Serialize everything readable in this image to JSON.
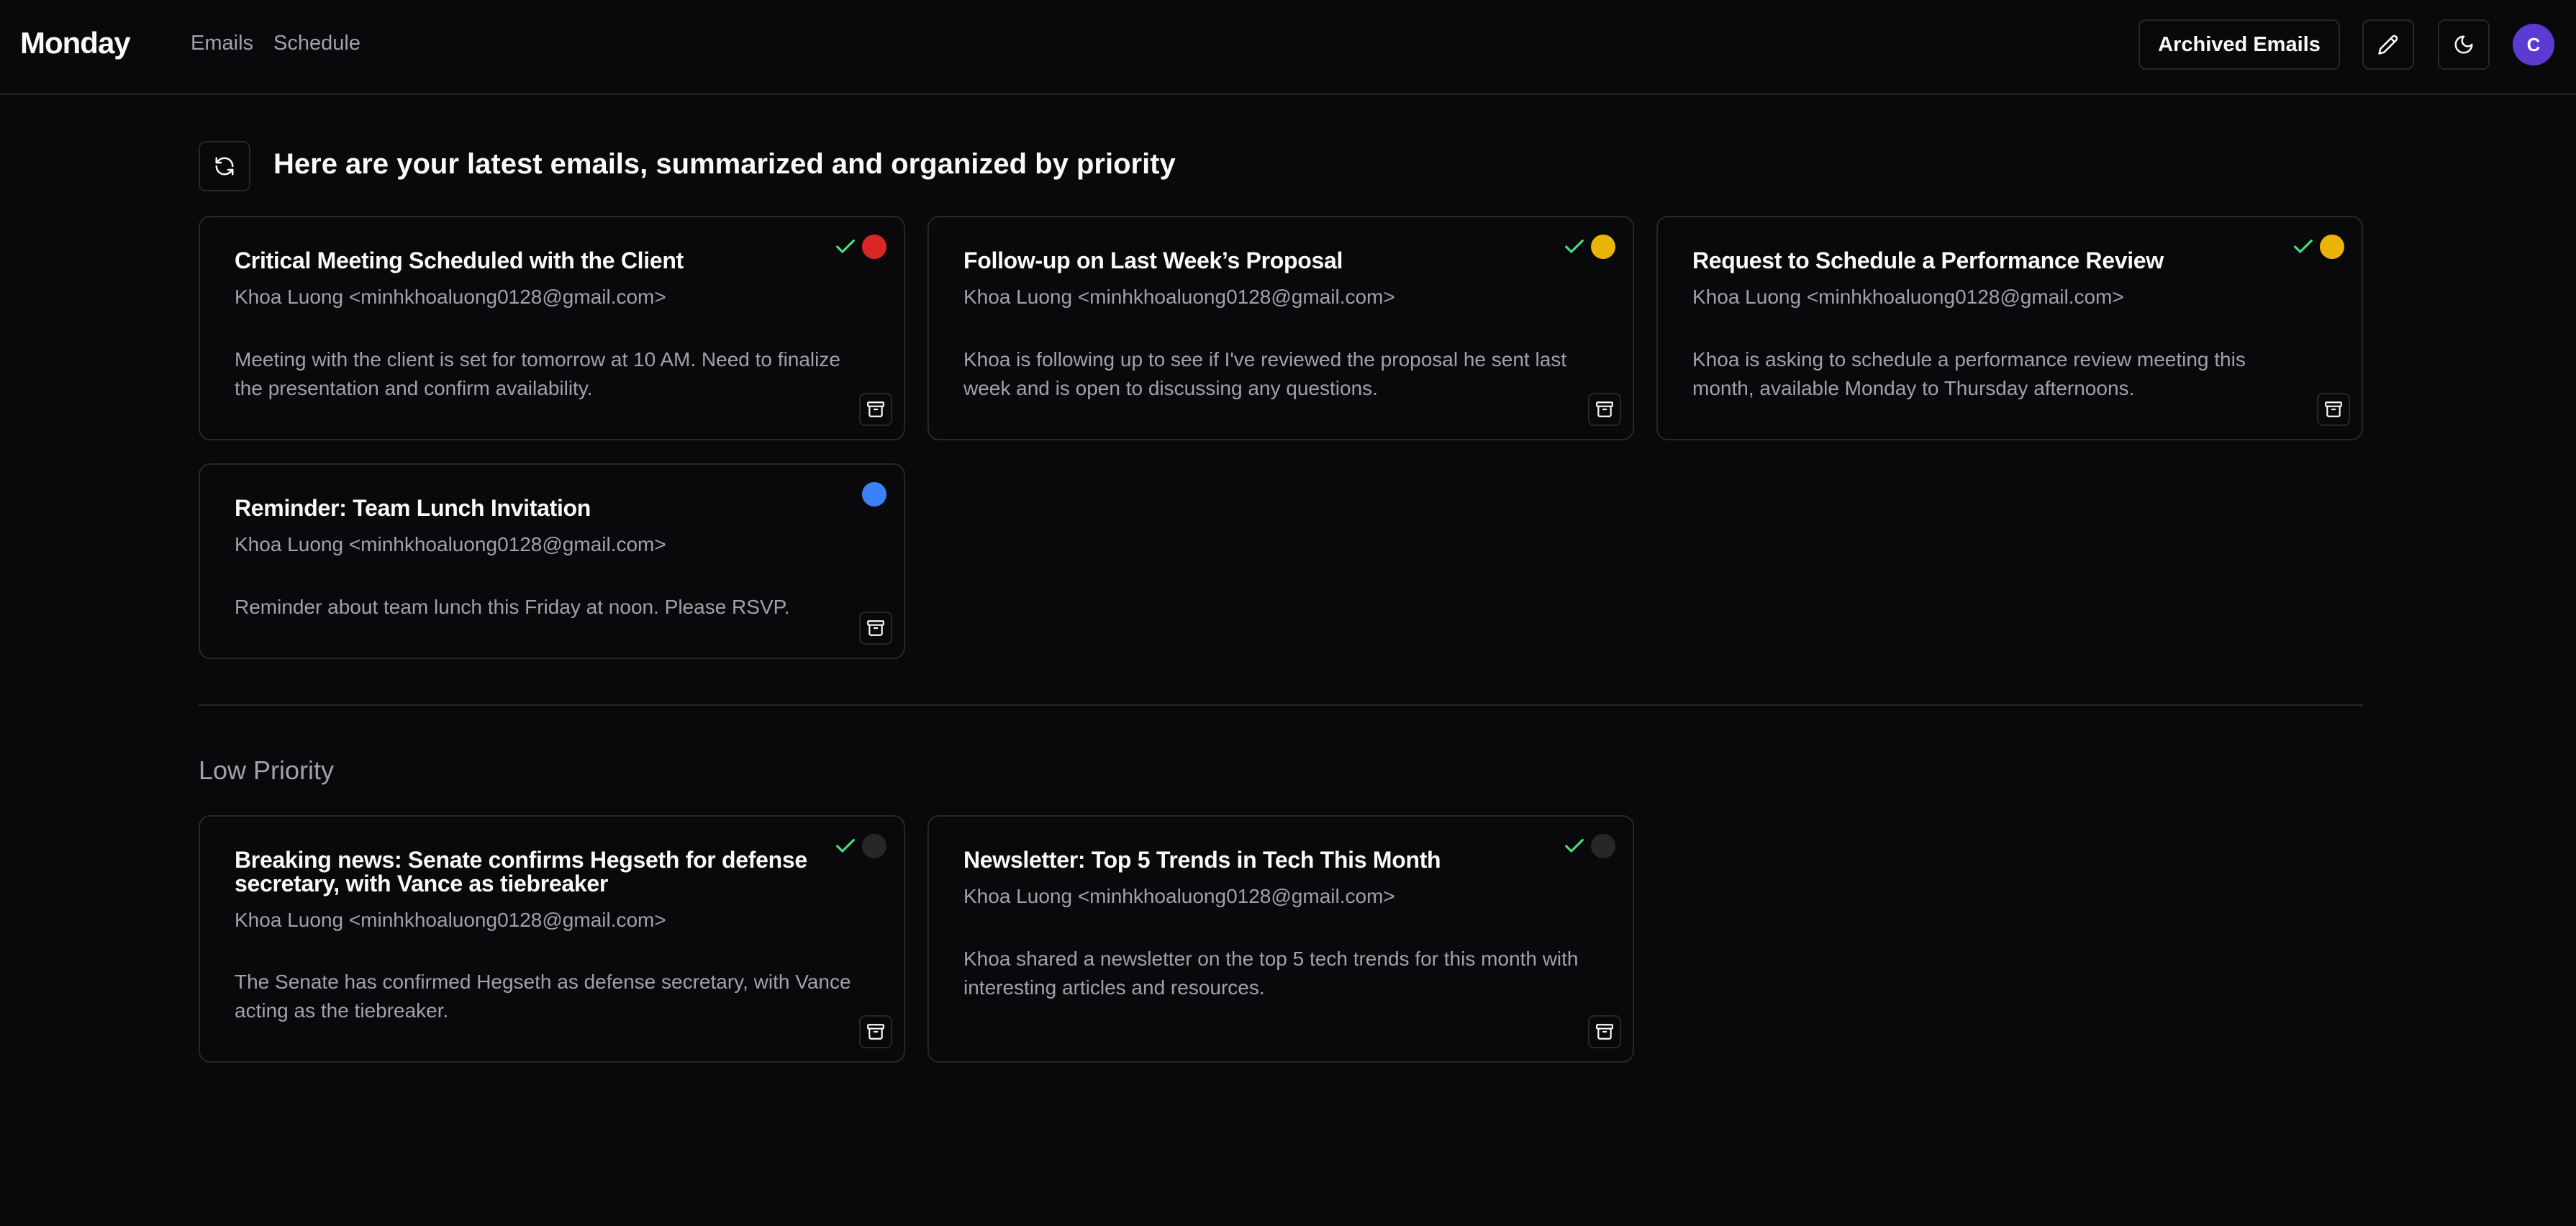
{
  "app": {
    "title": "Monday",
    "nav": [
      "Emails",
      "Schedule"
    ],
    "archived_label": "Archived Emails",
    "avatar_initial": "C",
    "accent_color": "#5b3bd1"
  },
  "main": {
    "heading": "Here are your latest emails, summarized and organized by priority",
    "low_priority_heading": "Low Priority"
  },
  "priority_colors": {
    "high": "#dc2626",
    "medium": "#eab308",
    "low": "#3b82f6",
    "none": "#27272a"
  },
  "emails": [
    {
      "title": "Critical Meeting Scheduled with the Client",
      "sender": "Khoa Luong <minhkhoaluong0128@gmail.com>",
      "summary": "Meeting with the client is set for tomorrow at 10 AM. Need to finalize the presentation and confirm availability.",
      "priority": "high",
      "checked": true
    },
    {
      "title": "Follow-up on Last Week’s Proposal",
      "sender": "Khoa Luong <minhkhoaluong0128@gmail.com>",
      "summary": "Khoa is following up to see if I've reviewed the proposal he sent last week and is open to discussing any questions.",
      "priority": "medium",
      "checked": true
    },
    {
      "title": "Request to Schedule a Performance Review",
      "sender": "Khoa Luong <minhkhoaluong0128@gmail.com>",
      "summary": "Khoa is asking to schedule a performance review meeting this month, available Monday to Thursday afternoons.",
      "priority": "medium",
      "checked": true
    },
    {
      "title": "Reminder: Team Lunch Invitation",
      "sender": "Khoa Luong <minhkhoaluong0128@gmail.com>",
      "summary": "Reminder about team lunch this Friday at noon. Please RSVP.",
      "priority": "low",
      "checked": false
    }
  ],
  "low_priority_emails": [
    {
      "title": "Breaking news: Senate confirms Hegseth for defense secretary, with Vance as tiebreaker",
      "sender": "Khoa Luong <minhkhoaluong0128@gmail.com>",
      "summary": "The Senate has confirmed Hegseth as defense secretary, with Vance acting as the tiebreaker.",
      "priority": "none",
      "checked": true
    },
    {
      "title": "Newsletter: Top 5 Trends in Tech This Month",
      "sender": "Khoa Luong <minhkhoaluong0128@gmail.com>",
      "summary": "Khoa shared a newsletter on the top 5 tech trends for this month with interesting articles and resources.",
      "priority": "none",
      "checked": true
    }
  ]
}
